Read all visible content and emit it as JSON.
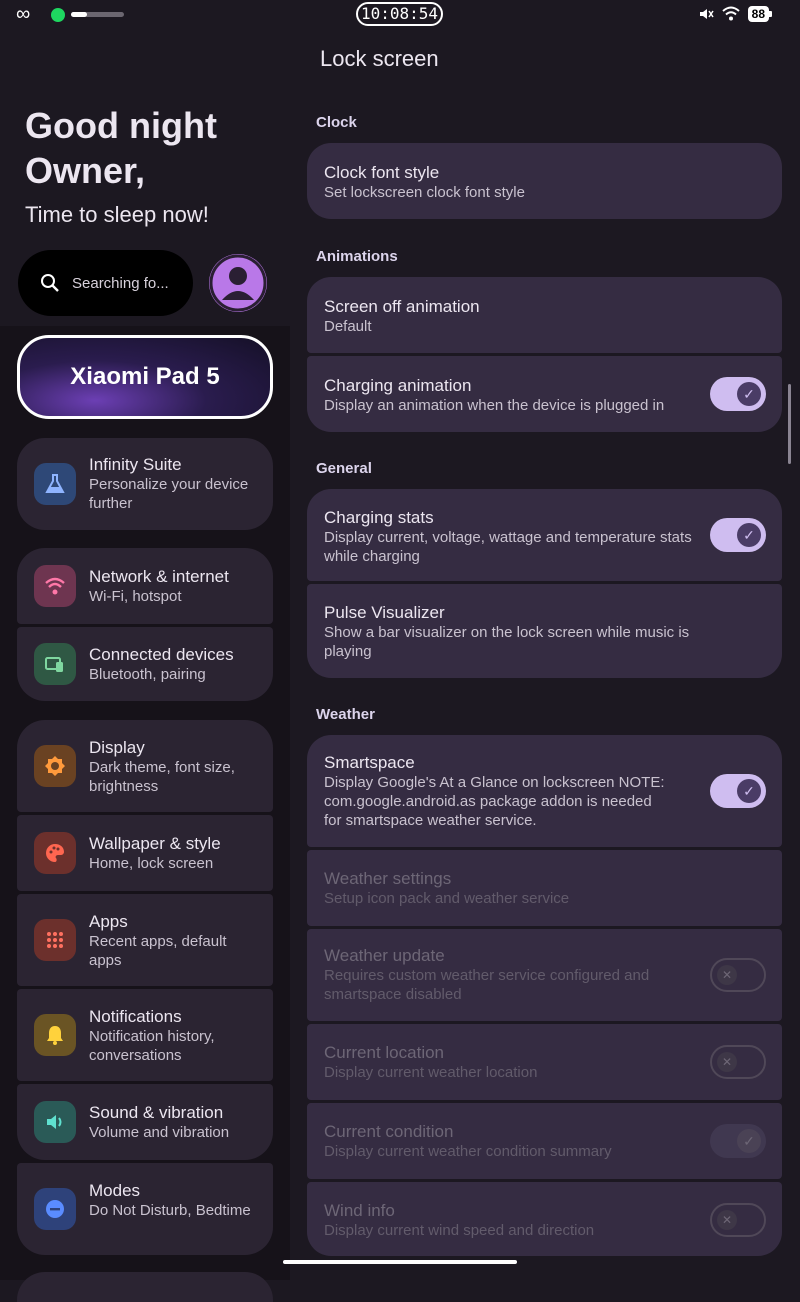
{
  "status_bar": {
    "time": "10:08:54",
    "battery": "88",
    "media_progress": 0.3
  },
  "left": {
    "greeting_line1": "Good night",
    "greeting_line2": "Owner,",
    "greeting_line3": "Time to sleep now!",
    "search_placeholder": "Searching fo...",
    "device_name": "Xiaomi Pad 5",
    "items": [
      {
        "title": "Infinity Suite",
        "subtitle": "Personalize your device further",
        "icon": "flask-icon",
        "color": "#7fa8ff"
      },
      {
        "title": "Network & internet",
        "subtitle": "Wi-Fi, hotspot",
        "icon": "wifi-icon",
        "color": "#ff6fa0"
      },
      {
        "title": "Connected devices",
        "subtitle": "Bluetooth, pairing",
        "icon": "devices-icon",
        "color": "#7fd7a0"
      },
      {
        "title": "Display",
        "subtitle": "Dark theme, font size, brightness",
        "icon": "brightness-icon",
        "color": "#ff9a3c"
      },
      {
        "title": "Wallpaper & style",
        "subtitle": "Home, lock screen",
        "icon": "palette-icon",
        "color": "#ff6650"
      },
      {
        "title": "Apps",
        "subtitle": "Recent apps, default apps",
        "icon": "apps-grid-icon",
        "color": "#ff7060"
      },
      {
        "title": "Notifications",
        "subtitle": "Notification history, conversations",
        "icon": "bell-icon",
        "color": "#ffd23c"
      },
      {
        "title": "Sound & vibration",
        "subtitle": "Volume and vibration",
        "icon": "volume-icon",
        "color": "#5fe0cf"
      },
      {
        "title": "Modes",
        "subtitle": "Do Not Disturb, Bedtime",
        "icon": "minus-circle-icon",
        "color": "#5a8cff"
      }
    ]
  },
  "right": {
    "title": "Lock screen",
    "sections": {
      "clock": "Clock",
      "animations": "Animations",
      "general": "General",
      "weather": "Weather"
    },
    "settings": {
      "clock_font": {
        "title": "Clock font style",
        "subtitle": "Set lockscreen clock font style"
      },
      "screen_off": {
        "title": "Screen off animation",
        "subtitle": "Default"
      },
      "charging_anim": {
        "title": "Charging animation",
        "subtitle": "Display an animation when the device is plugged in"
      },
      "charging_stats": {
        "title": "Charging stats",
        "subtitle": "Display current, voltage, wattage and temperature stats while charging"
      },
      "pulse": {
        "title": "Pulse Visualizer",
        "subtitle": "Show a bar visualizer on the lock screen while music is playing"
      },
      "smartspace": {
        "title": "Smartspace",
        "subtitle": "Display Google's At a Glance on lockscreen NOTE: com.google.android.as package addon is needed for smartspace weather service."
      },
      "weather_settings": {
        "title": "Weather settings",
        "subtitle": "Setup icon pack and weather service"
      },
      "weather_update": {
        "title": "Weather update",
        "subtitle": "Requires custom weather service configured and smartspace disabled"
      },
      "current_location": {
        "title": "Current location",
        "subtitle": "Display current weather location"
      },
      "current_condition": {
        "title": "Current condition",
        "subtitle": "Display current weather condition summary"
      },
      "wind_info": {
        "title": "Wind info",
        "subtitle": "Display current wind speed and direction"
      }
    }
  }
}
